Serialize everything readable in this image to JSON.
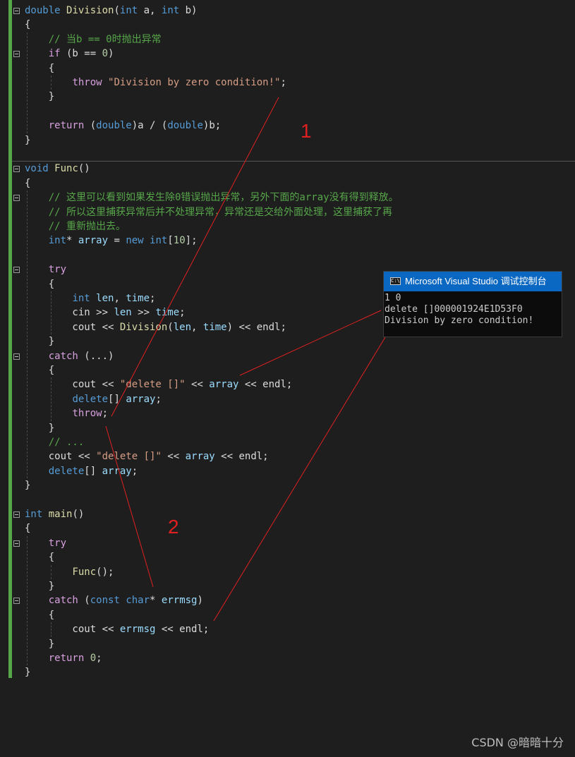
{
  "colors": {
    "background": "#1e1e1e",
    "keyword": "#569cd6",
    "control": "#d8a0df",
    "function": "#dcdcaa",
    "string": "#d69d85",
    "comment": "#57a64a",
    "number": "#b5cea8",
    "variable": "#9cdcfe",
    "annotation": "#e02020",
    "console_title_bg": "#0a67c2"
  },
  "code": {
    "lines": [
      [
        [
          "kw",
          "double"
        ],
        [
          "plain",
          " "
        ],
        [
          "fn",
          "Division"
        ],
        [
          "plain",
          "("
        ],
        [
          "kw",
          "int"
        ],
        [
          "plain",
          " a, "
        ],
        [
          "kw",
          "int"
        ],
        [
          "plain",
          " b)"
        ]
      ],
      [
        [
          "plain",
          "{"
        ]
      ],
      [
        [
          "plain",
          "    "
        ],
        [
          "cm",
          "// 当b == 0时抛出异常"
        ]
      ],
      [
        [
          "plain",
          "    "
        ],
        [
          "ctl",
          "if"
        ],
        [
          "plain",
          " (b == "
        ],
        [
          "num",
          "0"
        ],
        [
          "plain",
          ")"
        ]
      ],
      [
        [
          "plain",
          "    {"
        ]
      ],
      [
        [
          "plain",
          "        "
        ],
        [
          "ctl",
          "throw"
        ],
        [
          "plain",
          " "
        ],
        [
          "str",
          "\"Division by zero condition!\""
        ],
        [
          "plain",
          ";"
        ]
      ],
      [
        [
          "plain",
          "    }"
        ]
      ],
      [],
      [
        [
          "plain",
          "    "
        ],
        [
          "ctl",
          "return"
        ],
        [
          "plain",
          " ("
        ],
        [
          "kw",
          "double"
        ],
        [
          "plain",
          ")a / ("
        ],
        [
          "kw",
          "double"
        ],
        [
          "plain",
          ")b;"
        ]
      ],
      [
        [
          "plain",
          "}"
        ]
      ],
      [],
      [
        [
          "kw",
          "void"
        ],
        [
          "plain",
          " "
        ],
        [
          "fn",
          "Func"
        ],
        [
          "plain",
          "()"
        ]
      ],
      [
        [
          "plain",
          "{"
        ]
      ],
      [
        [
          "plain",
          "    "
        ],
        [
          "cm",
          "// 这里可以看到如果发生除0错误抛出异常，另外下面的array没有得到释放。"
        ]
      ],
      [
        [
          "plain",
          "    "
        ],
        [
          "cm",
          "// 所以这里捕获异常后并不处理异常，异常还是交给外面处理，这里捕获了再"
        ]
      ],
      [
        [
          "plain",
          "    "
        ],
        [
          "cm",
          "// 重新抛出去。"
        ]
      ],
      [
        [
          "plain",
          "    "
        ],
        [
          "kw",
          "int"
        ],
        [
          "plain",
          "* "
        ],
        [
          "var",
          "array"
        ],
        [
          "plain",
          " = "
        ],
        [
          "kw",
          "new"
        ],
        [
          "plain",
          " "
        ],
        [
          "kw",
          "int"
        ],
        [
          "plain",
          "["
        ],
        [
          "num",
          "10"
        ],
        [
          "plain",
          "];"
        ]
      ],
      [],
      [
        [
          "plain",
          "    "
        ],
        [
          "ctl",
          "try"
        ]
      ],
      [
        [
          "plain",
          "    {"
        ]
      ],
      [
        [
          "plain",
          "        "
        ],
        [
          "kw",
          "int"
        ],
        [
          "plain",
          " "
        ],
        [
          "var",
          "len"
        ],
        [
          "plain",
          ", "
        ],
        [
          "var",
          "time"
        ],
        [
          "plain",
          ";"
        ]
      ],
      [
        [
          "plain",
          "        cin >> "
        ],
        [
          "var",
          "len"
        ],
        [
          "plain",
          " >> "
        ],
        [
          "var",
          "time"
        ],
        [
          "plain",
          ";"
        ]
      ],
      [
        [
          "plain",
          "        cout << "
        ],
        [
          "fn",
          "Division"
        ],
        [
          "plain",
          "("
        ],
        [
          "var",
          "len"
        ],
        [
          "plain",
          ", "
        ],
        [
          "var",
          "time"
        ],
        [
          "plain",
          ") << endl;"
        ]
      ],
      [
        [
          "plain",
          "    }"
        ]
      ],
      [
        [
          "plain",
          "    "
        ],
        [
          "ctl",
          "catch"
        ],
        [
          "plain",
          " (...)"
        ]
      ],
      [
        [
          "plain",
          "    {"
        ]
      ],
      [
        [
          "plain",
          "        cout << "
        ],
        [
          "str",
          "\"delete []\""
        ],
        [
          "plain",
          " << "
        ],
        [
          "var",
          "array"
        ],
        [
          "plain",
          " << endl;"
        ]
      ],
      [
        [
          "plain",
          "        "
        ],
        [
          "kw",
          "delete"
        ],
        [
          "plain",
          "[] "
        ],
        [
          "var",
          "array"
        ],
        [
          "plain",
          ";"
        ]
      ],
      [
        [
          "plain",
          "        "
        ],
        [
          "ctl",
          "throw"
        ],
        [
          "plain",
          ";"
        ]
      ],
      [
        [
          "plain",
          "    }"
        ]
      ],
      [
        [
          "plain",
          "    "
        ],
        [
          "cm",
          "// ..."
        ]
      ],
      [
        [
          "plain",
          "    cout << "
        ],
        [
          "str",
          "\"delete []\""
        ],
        [
          "plain",
          " << "
        ],
        [
          "var",
          "array"
        ],
        [
          "plain",
          " << endl;"
        ]
      ],
      [
        [
          "plain",
          "    "
        ],
        [
          "kw",
          "delete"
        ],
        [
          "plain",
          "[] "
        ],
        [
          "var",
          "array"
        ],
        [
          "plain",
          ";"
        ]
      ],
      [
        [
          "plain",
          "}"
        ]
      ],
      [],
      [
        [
          "kw",
          "int"
        ],
        [
          "plain",
          " "
        ],
        [
          "fn",
          "main"
        ],
        [
          "plain",
          "()"
        ]
      ],
      [
        [
          "plain",
          "{"
        ]
      ],
      [
        [
          "plain",
          "    "
        ],
        [
          "ctl",
          "try"
        ]
      ],
      [
        [
          "plain",
          "    {"
        ]
      ],
      [
        [
          "plain",
          "        "
        ],
        [
          "fn",
          "Func"
        ],
        [
          "plain",
          "();"
        ]
      ],
      [
        [
          "plain",
          "    }"
        ]
      ],
      [
        [
          "plain",
          "    "
        ],
        [
          "ctl",
          "catch"
        ],
        [
          "plain",
          " ("
        ],
        [
          "kw",
          "const"
        ],
        [
          "plain",
          " "
        ],
        [
          "kw",
          "char"
        ],
        [
          "plain",
          "* "
        ],
        [
          "var",
          "errmsg"
        ],
        [
          "plain",
          ")"
        ]
      ],
      [
        [
          "plain",
          "    {"
        ]
      ],
      [
        [
          "plain",
          "        cout << "
        ],
        [
          "var",
          "errmsg"
        ],
        [
          "plain",
          " << endl;"
        ]
      ],
      [
        [
          "plain",
          "    }"
        ]
      ],
      [
        [
          "plain",
          "    "
        ],
        [
          "ctl",
          "return"
        ],
        [
          "plain",
          " "
        ],
        [
          "num",
          "0"
        ],
        [
          "plain",
          ";"
        ]
      ],
      [
        [
          "plain",
          "}"
        ]
      ]
    ]
  },
  "console": {
    "title": "Microsoft Visual Studio 调试控制台",
    "icon": "console-app-icon",
    "icon_glyph": "C:\\",
    "output": "1 0\ndelete []000001924E1D53F0\nDivision by zero condition!"
  },
  "annotations": {
    "label_1": "1",
    "label_2": "2"
  },
  "watermark": "CSDN @暗暗十分"
}
